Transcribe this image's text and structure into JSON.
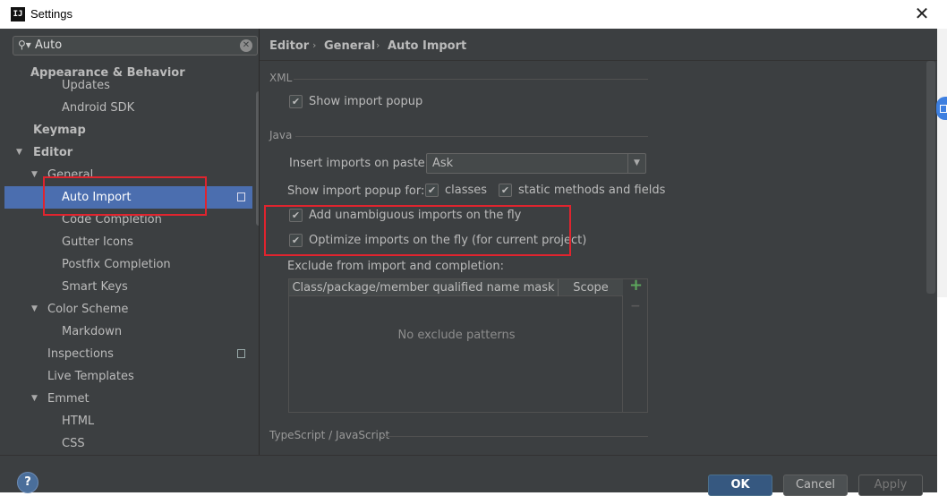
{
  "window": {
    "title": "Settings",
    "app_icon": "IJ",
    "close_glyph": "✕"
  },
  "search": {
    "value": "Auto",
    "icon": "search-icon",
    "clear_icon": "clear-icon"
  },
  "sidebar": {
    "items": [
      {
        "label": "Appearance & Behavior",
        "level": 0,
        "bold": true,
        "arrow": ""
      },
      {
        "label": "Updates",
        "level": 2,
        "bold": false,
        "arrow": ""
      },
      {
        "label": "Android SDK",
        "level": 2,
        "bold": false,
        "arrow": ""
      },
      {
        "label": "Keymap",
        "level": 0,
        "bold": true,
        "arrow": ""
      },
      {
        "label": "Editor",
        "level": 0,
        "bold": true,
        "arrow": "▼"
      },
      {
        "label": "General",
        "level": 1,
        "bold": false,
        "arrow": "▼"
      },
      {
        "label": "Auto Import",
        "level": 2,
        "bold": false,
        "arrow": "",
        "selected": true
      },
      {
        "label": "Code Completion",
        "level": 2,
        "bold": false,
        "arrow": ""
      },
      {
        "label": "Gutter Icons",
        "level": 2,
        "bold": false,
        "arrow": ""
      },
      {
        "label": "Postfix Completion",
        "level": 2,
        "bold": false,
        "arrow": ""
      },
      {
        "label": "Smart Keys",
        "level": 2,
        "bold": false,
        "arrow": ""
      },
      {
        "label": "Color Scheme",
        "level": 1,
        "bold": false,
        "arrow": "▼"
      },
      {
        "label": "Markdown",
        "level": 2,
        "bold": false,
        "arrow": ""
      },
      {
        "label": "Inspections",
        "level": 1,
        "bold": false,
        "arrow": ""
      },
      {
        "label": "Live Templates",
        "level": 1,
        "bold": false,
        "arrow": ""
      },
      {
        "label": "Emmet",
        "level": 1,
        "bold": false,
        "arrow": "▼"
      },
      {
        "label": "HTML",
        "level": 2,
        "bold": false,
        "arrow": ""
      },
      {
        "label": "CSS",
        "level": 2,
        "bold": false,
        "arrow": ""
      }
    ]
  },
  "breadcrumb": {
    "items": [
      "Editor",
      "General",
      "Auto Import"
    ],
    "separator": "›"
  },
  "xml": {
    "section_title": "XML",
    "show_import_popup": {
      "label": "Show import popup",
      "checked": true
    }
  },
  "java": {
    "section_title": "Java",
    "insert_on_paste_label": "Insert imports on paste:",
    "insert_on_paste_value": "Ask",
    "show_popup_for_label": "Show import popup for:",
    "classes": {
      "label": "classes",
      "checked": true
    },
    "static_methods": {
      "label": "static methods and fields",
      "checked": true
    },
    "add_unambiguous": {
      "label": "Add unambiguous imports on the fly",
      "checked": true
    },
    "optimize_imports": {
      "label": "Optimize imports on the fly (for current project)",
      "checked": true
    },
    "exclude_label": "Exclude from import and completion:",
    "table": {
      "columns": [
        "Class/package/member qualified name mask",
        "Scope"
      ],
      "empty_text": "No exclude patterns"
    },
    "add_glyph": "+",
    "remove_glyph": "−"
  },
  "typescript": {
    "section_title": "TypeScript / JavaScript"
  },
  "footer": {
    "help_label": "?",
    "ok_label": "OK",
    "cancel_label": "Cancel",
    "apply_label": "Apply"
  },
  "colors": {
    "background": "#3c3f41",
    "selection": "#4b6eaf",
    "highlight_box": "#e0242e",
    "ok_button": "#365880"
  }
}
